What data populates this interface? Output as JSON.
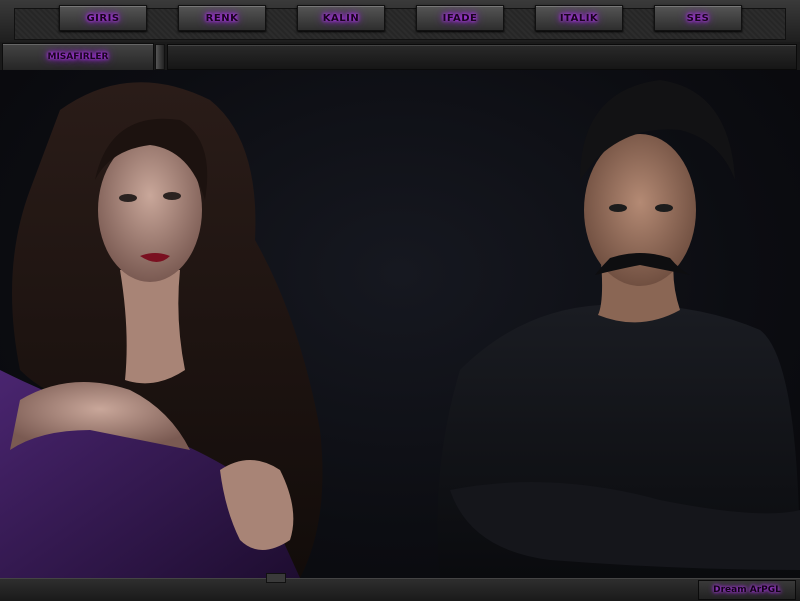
{
  "nav": {
    "tabs": [
      {
        "label": "GIRIS"
      },
      {
        "label": "RENK"
      },
      {
        "label": "KALIN"
      },
      {
        "label": "IFADE"
      },
      {
        "label": "ITALIK"
      },
      {
        "label": "SES"
      }
    ]
  },
  "guests": {
    "label": "MISAFIRLER"
  },
  "footer": {
    "credit": "Dream ArPGL"
  },
  "colors": {
    "glow": "#b030f0",
    "bar": "#2a2a2a",
    "background": "#0c0d10",
    "dress": "#3a1a5c"
  }
}
